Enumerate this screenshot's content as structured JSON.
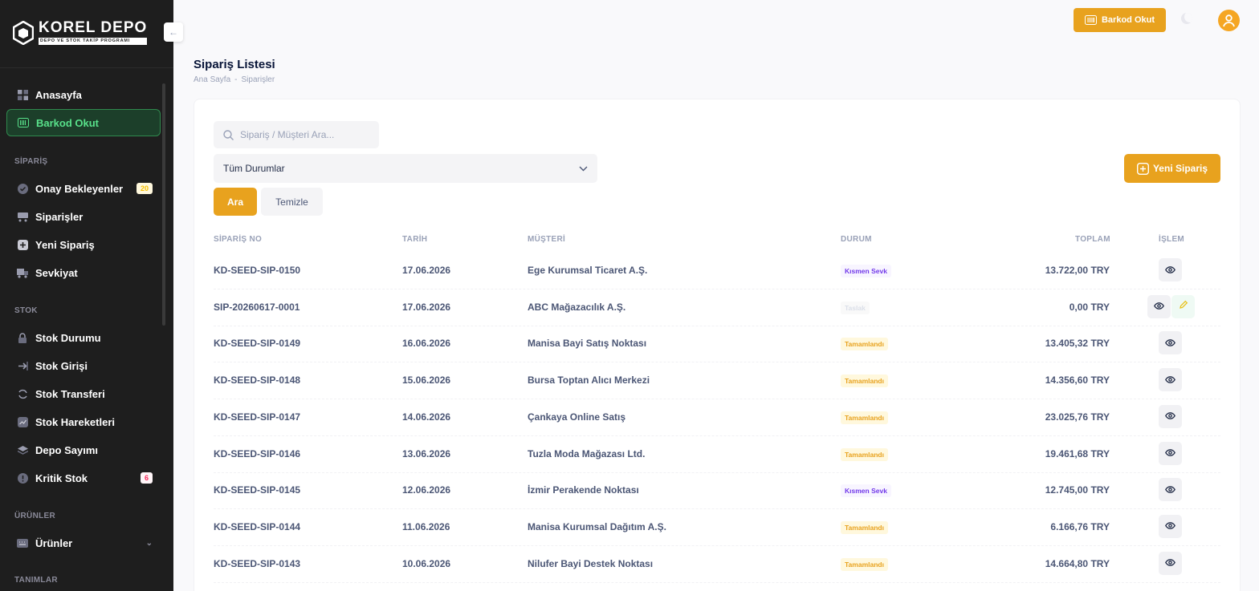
{
  "brand": {
    "name": "KOREL DEPO",
    "tagline": "DEPO VE STOK TAKİP PROGRAMI"
  },
  "sidebar": {
    "items_top": [
      {
        "label": "Anasayfa",
        "icon": "grid-icon"
      },
      {
        "label": "Barkod Okut",
        "icon": "barcode-icon"
      }
    ],
    "siparis_title": "SİPARİŞ",
    "siparis_items": [
      {
        "label": "Onay Bekleyenler",
        "icon": "check-circle-icon",
        "badge": "20"
      },
      {
        "label": "Siparişler",
        "icon": "cart-icon"
      },
      {
        "label": "Yeni Sipariş",
        "icon": "plus-square-icon"
      },
      {
        "label": "Sevkiyat",
        "icon": "truck-icon"
      }
    ],
    "stok_title": "STOK",
    "stok_items": [
      {
        "label": "Stok Durumu",
        "icon": "lock-icon"
      },
      {
        "label": "Stok Girişi",
        "icon": "arrow-right-icon"
      },
      {
        "label": "Stok Transferi",
        "icon": "refresh-icon"
      },
      {
        "label": "Stok Hareketleri",
        "icon": "chart-icon"
      },
      {
        "label": "Depo Sayımı",
        "icon": "layers-icon"
      },
      {
        "label": "Kritik Stok",
        "icon": "alert-icon",
        "badge": "6"
      }
    ],
    "urunler_title": "ÜRÜNLER",
    "urunler_items": [
      {
        "label": "Ürünler",
        "icon": "keyboard-icon"
      }
    ],
    "tanimlar_title": "TANIMLAR"
  },
  "header": {
    "barkod_label": "Barkod Okut"
  },
  "page": {
    "title": "Sipariş Listesi",
    "breadcrumb": [
      "Ana Sayfa",
      "-",
      "Siparişler"
    ]
  },
  "filters": {
    "search_placeholder": "Sipariş / Müşteri Ara...",
    "status_selected": "Tüm Durumlar",
    "search_button": "Ara",
    "clear_button": "Temizle",
    "new_order_button": "Yeni Sipariş"
  },
  "table": {
    "headers": [
      "SİPARİŞ NO",
      "TARİH",
      "MÜŞTERİ",
      "DURUM",
      "TOPLAM",
      "İŞLEM"
    ],
    "rows": [
      {
        "no": "KD-SEED-SIP-0150",
        "date": "17.06.2026",
        "customer": "Ege Kurumsal Ticaret A.Ş.",
        "status": "Kısmen Sevk",
        "status_type": "kismen",
        "total": "13.722,00 TRY",
        "editable": false
      },
      {
        "no": "SIP-20260617-0001",
        "date": "17.06.2026",
        "customer": "ABC Mağazacılık A.Ş.",
        "status": "Taslak",
        "status_type": "taslak",
        "total": "0,00 TRY",
        "editable": true
      },
      {
        "no": "KD-SEED-SIP-0149",
        "date": "16.06.2026",
        "customer": "Manisa Bayi Satış Noktası",
        "status": "Tamamlandı",
        "status_type": "tamam",
        "total": "13.405,32 TRY",
        "editable": false
      },
      {
        "no": "KD-SEED-SIP-0148",
        "date": "15.06.2026",
        "customer": "Bursa Toptan Alıcı Merkezi",
        "status": "Tamamlandı",
        "status_type": "tamam",
        "total": "14.356,60 TRY",
        "editable": false
      },
      {
        "no": "KD-SEED-SIP-0147",
        "date": "14.06.2026",
        "customer": "Çankaya Online Satış",
        "status": "Tamamlandı",
        "status_type": "tamam",
        "total": "23.025,76 TRY",
        "editable": false
      },
      {
        "no": "KD-SEED-SIP-0146",
        "date": "13.06.2026",
        "customer": "Tuzla Moda Mağazası Ltd.",
        "status": "Tamamlandı",
        "status_type": "tamam",
        "total": "19.461,68 TRY",
        "editable": false
      },
      {
        "no": "KD-SEED-SIP-0145",
        "date": "12.06.2026",
        "customer": "İzmir Perakende Noktası",
        "status": "Kısmen Sevk",
        "status_type": "kismen",
        "total": "12.745,00 TRY",
        "editable": false
      },
      {
        "no": "KD-SEED-SIP-0144",
        "date": "11.06.2026",
        "customer": "Manisa Kurumsal Dağıtım A.Ş.",
        "status": "Tamamlandı",
        "status_type": "tamam",
        "total": "6.166,76 TRY",
        "editable": false
      },
      {
        "no": "KD-SEED-SIP-0143",
        "date": "10.06.2026",
        "customer": "Nilufer Bayi Destek Noktası",
        "status": "Tamamlandı",
        "status_type": "tamam",
        "total": "14.664,80 TRY",
        "editable": false
      }
    ]
  },
  "colors": {
    "accent": "#e8a21e",
    "sidebar_bg": "#1e1e1e",
    "active_green": "#58e08a"
  }
}
